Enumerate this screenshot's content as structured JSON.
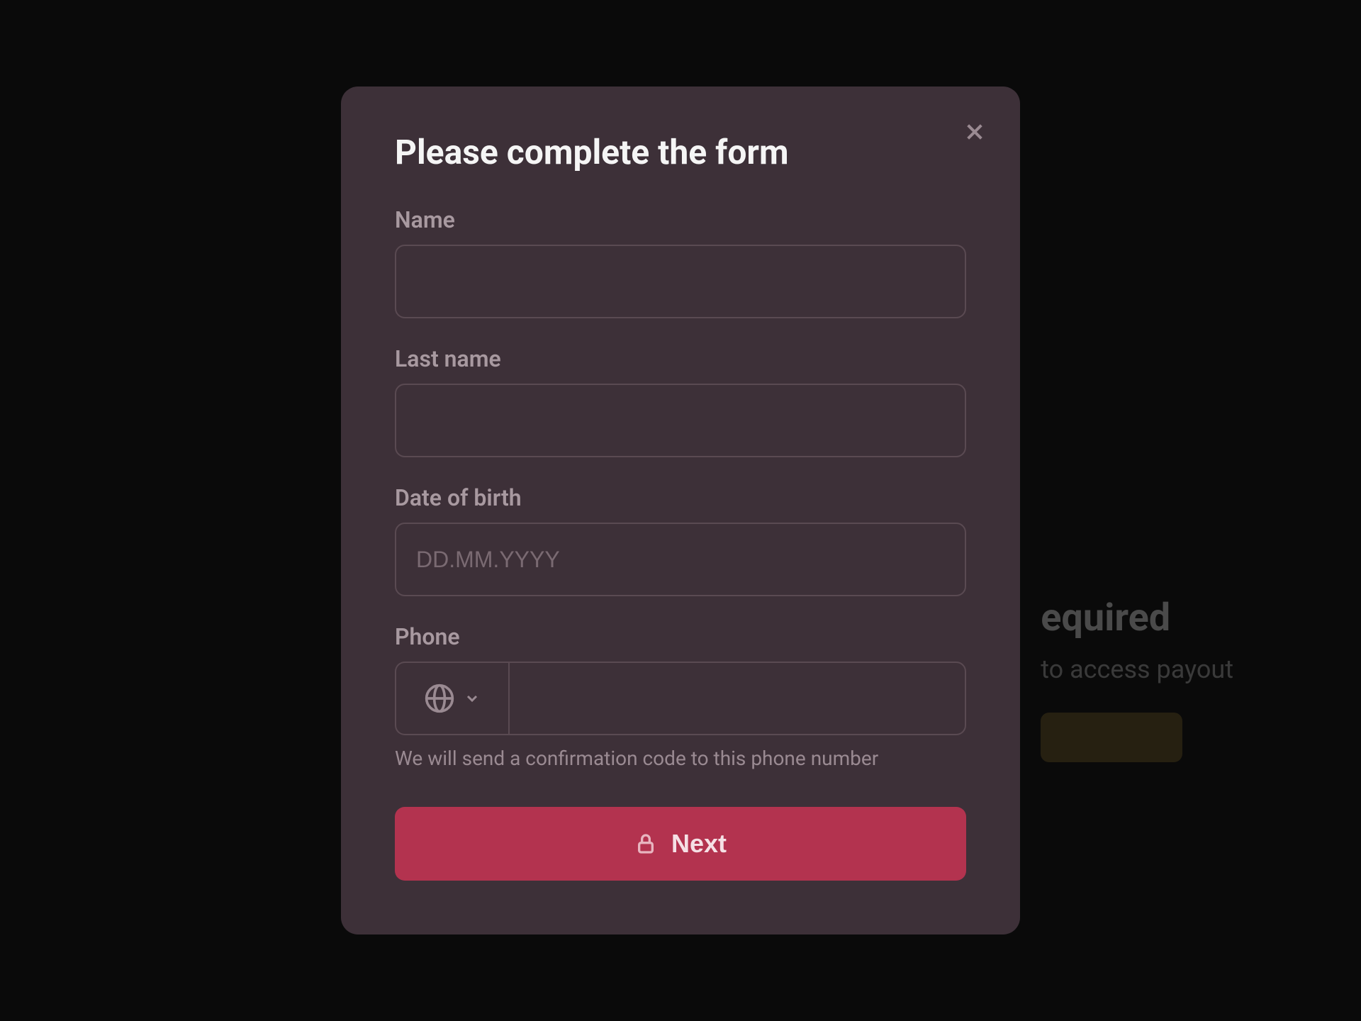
{
  "background": {
    "title_partial": "equired",
    "subtitle_partial": "to access payout"
  },
  "modal": {
    "title": "Please complete the form",
    "fields": {
      "name": {
        "label": "Name",
        "value": "",
        "placeholder": ""
      },
      "lastname": {
        "label": "Last name",
        "value": "",
        "placeholder": ""
      },
      "dob": {
        "label": "Date of birth",
        "value": "",
        "placeholder": "DD.MM.YYYY"
      },
      "phone": {
        "label": "Phone",
        "value": "",
        "placeholder": "",
        "helper": "We will send a confirmation code to this phone number"
      }
    },
    "buttons": {
      "next": "Next"
    }
  }
}
